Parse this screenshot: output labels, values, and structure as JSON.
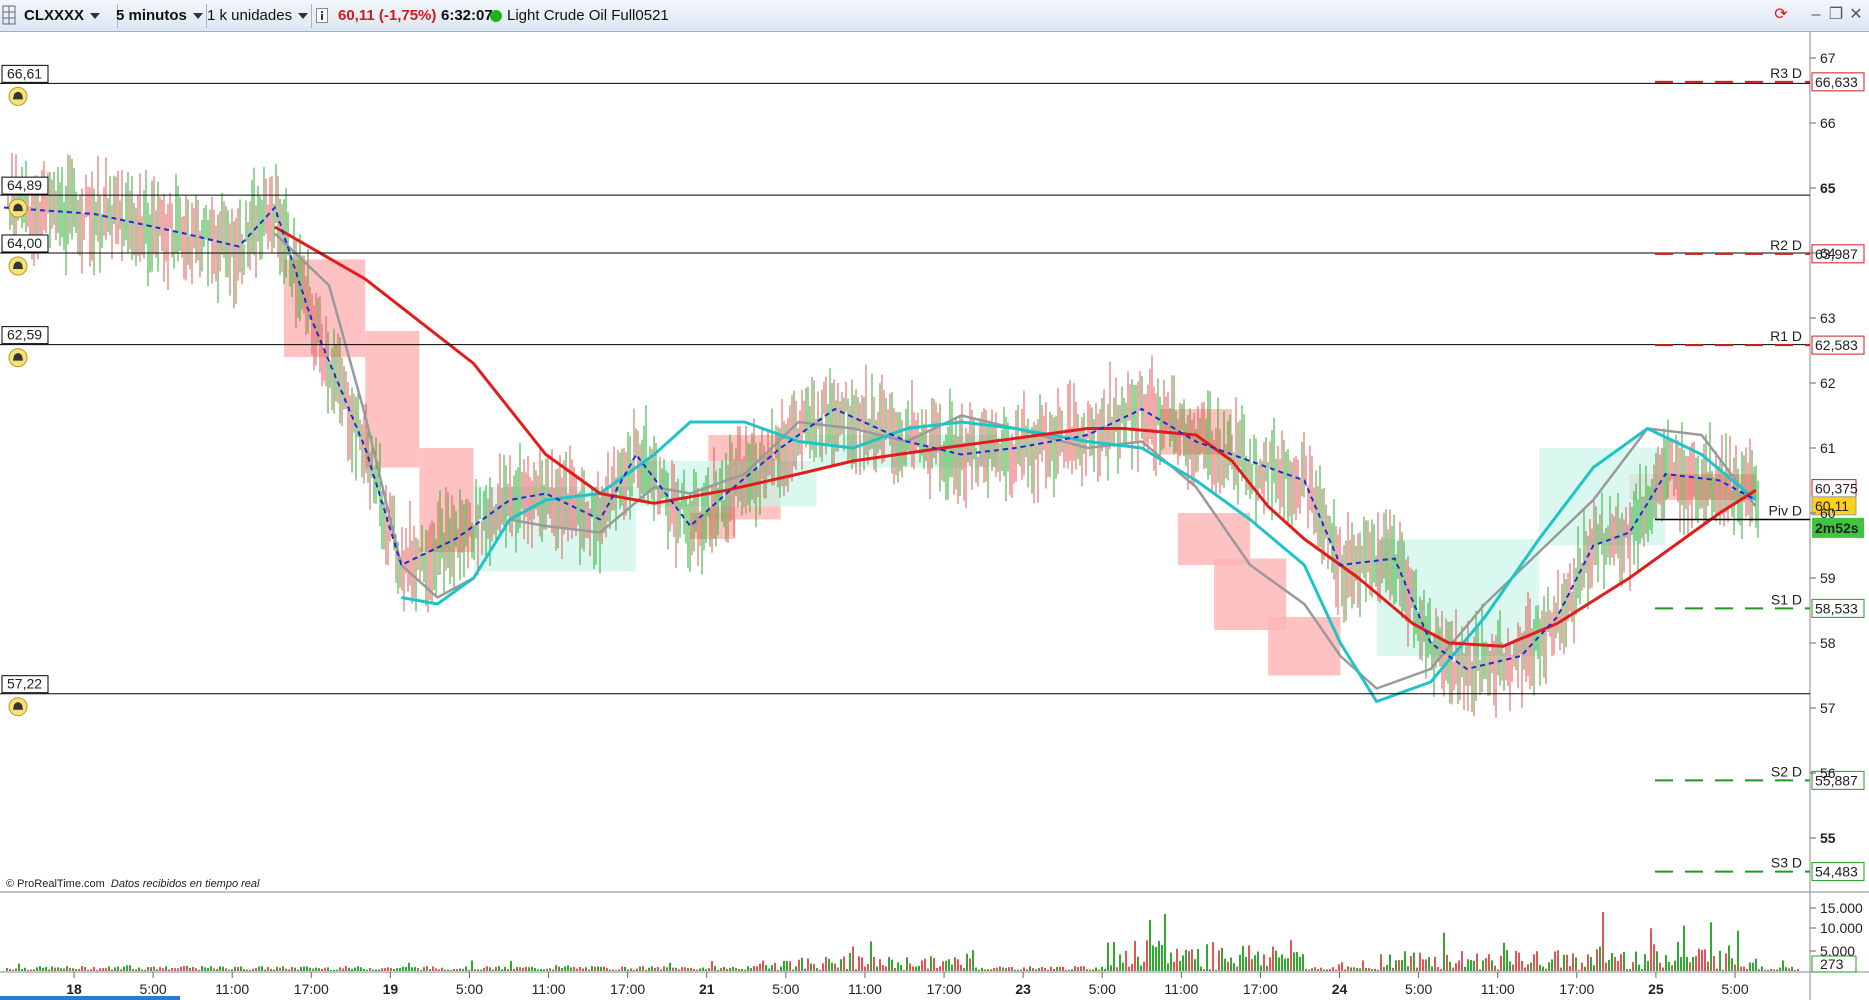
{
  "toolbar": {
    "symbol": "CLXXXX",
    "timeframe": "5 minutos",
    "units": "1 k unidades",
    "info_icon": "info-icon",
    "last_price": "60,11 (-1,75%)",
    "time": "6:32:07",
    "status_color": "#1db31d",
    "instrument": "Light Crude Oil Full0521"
  },
  "footer": {
    "copyright": "© ProRealTime.com",
    "realtime": "Datos recibidos en tiempo real"
  },
  "chart_data": {
    "type": "line",
    "title": "",
    "price_axis": {
      "range": [
        54.2,
        67.4
      ],
      "ticks": [
        "67",
        "66",
        "65",
        "64",
        "63",
        "62",
        "61",
        "60",
        "59",
        "58",
        "57",
        "56",
        "55"
      ]
    },
    "volume_axis": {
      "ticks": [
        "15.000",
        "10.000",
        "5.000"
      ],
      "last_volume": "273"
    },
    "time_axis": {
      "labels": [
        "18",
        "5:00",
        "11:00",
        "17:00",
        "19",
        "5:00",
        "11:00",
        "17:00",
        "21",
        "5:00",
        "11:00",
        "17:00",
        "23",
        "5:00",
        "11:00",
        "17:00",
        "24",
        "5:00",
        "11:00",
        "17:00",
        "25",
        "5:00"
      ],
      "bold": [
        "18",
        "19",
        "21",
        "23",
        "24",
        "25"
      ]
    },
    "alert_lines": [
      {
        "label": "66,61",
        "value": 66.61
      },
      {
        "label": "64,89",
        "value": 64.89
      },
      {
        "label": "64,00",
        "value": 64.0
      },
      {
        "label": "62,59",
        "value": 62.59
      },
      {
        "label": "57,22",
        "value": 57.22
      }
    ],
    "pivots": [
      {
        "name": "R3 D",
        "value": 66.633,
        "label": "66,633",
        "color": "#d21a1a"
      },
      {
        "name": "R2 D",
        "value": 63.987,
        "label": "63,987",
        "color": "#d21a1a"
      },
      {
        "name": "R1 D",
        "value": 62.583,
        "label": "62,583",
        "color": "#d21a1a"
      },
      {
        "name": "Piv D",
        "value": 59.9,
        "label": "",
        "color": "#000000"
      },
      {
        "name": "S1 D",
        "value": 58.533,
        "label": "58,533",
        "color": "#1f9a1f"
      },
      {
        "name": "S2 D",
        "value": 55.887,
        "label": "55,887",
        "color": "#1f9a1f"
      },
      {
        "name": "S3 D",
        "value": 54.483,
        "label": "54,483",
        "color": "#1f9a1f"
      }
    ],
    "price_labels": [
      {
        "label": "60,375",
        "value": 60.375,
        "color": "#d21a1a"
      },
      {
        "label": "60,11",
        "value": 60.11,
        "color": "#000000",
        "bg": "#ffd21a"
      }
    ],
    "countdown": "2m52s",
    "colors": {
      "sma_long": "#e41b1b",
      "ema_dash": "#1a2fd6",
      "cyan": "#1fc4c9",
      "gray": "#9a9a9a",
      "cloud_red": "#ffb3b3",
      "cloud_green": "#ccf5ea"
    },
    "series": [
      {
        "key": "sma_long",
        "x": [
          0.15,
          0.2,
          0.26,
          0.3,
          0.33,
          0.36,
          0.4,
          0.44,
          0.47,
          0.52,
          0.56,
          0.6,
          0.62,
          0.66,
          0.68,
          0.7,
          0.72,
          0.75,
          0.78,
          0.8,
          0.83,
          0.86,
          0.9,
          0.93,
          0.95,
          0.97
        ],
        "y": [
          64.4,
          63.6,
          62.3,
          60.9,
          60.3,
          60.15,
          60.35,
          60.6,
          60.8,
          61.0,
          61.15,
          61.3,
          61.3,
          61.2,
          60.8,
          60.1,
          59.6,
          59.0,
          58.3,
          58.0,
          57.95,
          58.3,
          59.0,
          59.6,
          60.0,
          60.35
        ]
      },
      {
        "key": "ema_dash",
        "x": [
          0.0,
          0.05,
          0.1,
          0.13,
          0.15,
          0.17,
          0.2,
          0.22,
          0.25,
          0.28,
          0.3,
          0.33,
          0.35,
          0.38,
          0.4,
          0.43,
          0.46,
          0.5,
          0.53,
          0.56,
          0.6,
          0.63,
          0.66,
          0.68,
          0.7,
          0.72,
          0.74,
          0.77,
          0.79,
          0.81,
          0.84,
          0.86,
          0.88,
          0.9,
          0.92,
          0.95,
          0.97
        ],
        "y": [
          64.7,
          64.6,
          64.3,
          64.1,
          64.7,
          63.0,
          61.0,
          59.2,
          59.6,
          60.2,
          60.3,
          59.9,
          60.9,
          59.8,
          60.3,
          61.0,
          61.6,
          61.1,
          60.9,
          61.0,
          61.2,
          61.6,
          61.1,
          60.9,
          60.7,
          60.5,
          59.2,
          59.3,
          58.0,
          57.6,
          57.8,
          58.4,
          59.5,
          59.7,
          60.6,
          60.5,
          60.2
        ]
      },
      {
        "key": "gray",
        "x": [
          0.15,
          0.18,
          0.2,
          0.22,
          0.24,
          0.26,
          0.28,
          0.3,
          0.33,
          0.36,
          0.38,
          0.41,
          0.44,
          0.47,
          0.5,
          0.53,
          0.56,
          0.6,
          0.63,
          0.66,
          0.69,
          0.72,
          0.74,
          0.76,
          0.79,
          0.82,
          0.85,
          0.88,
          0.91,
          0.94,
          0.97
        ],
        "y": [
          64.3,
          63.5,
          61.5,
          59.2,
          58.7,
          59.0,
          59.9,
          59.8,
          59.7,
          60.4,
          60.3,
          60.6,
          61.4,
          61.3,
          61.1,
          61.5,
          61.3,
          61.0,
          61.1,
          60.4,
          59.2,
          58.6,
          57.8,
          57.3,
          57.6,
          58.6,
          59.4,
          60.2,
          61.3,
          61.2,
          60.1
        ]
      },
      {
        "key": "cyan",
        "x": [
          0.22,
          0.24,
          0.26,
          0.28,
          0.3,
          0.33,
          0.36,
          0.38,
          0.41,
          0.44,
          0.47,
          0.5,
          0.53,
          0.56,
          0.6,
          0.63,
          0.66,
          0.69,
          0.72,
          0.74,
          0.76,
          0.79,
          0.82,
          0.85,
          0.88,
          0.91,
          0.94,
          0.97
        ],
        "y": [
          58.7,
          58.6,
          59.0,
          59.9,
          60.2,
          60.3,
          60.9,
          61.4,
          61.4,
          61.1,
          61.0,
          61.3,
          61.4,
          61.3,
          61.1,
          61.0,
          60.5,
          59.9,
          59.2,
          58.0,
          57.1,
          57.4,
          58.4,
          59.6,
          60.7,
          61.3,
          60.9,
          60.2
        ]
      }
    ]
  }
}
